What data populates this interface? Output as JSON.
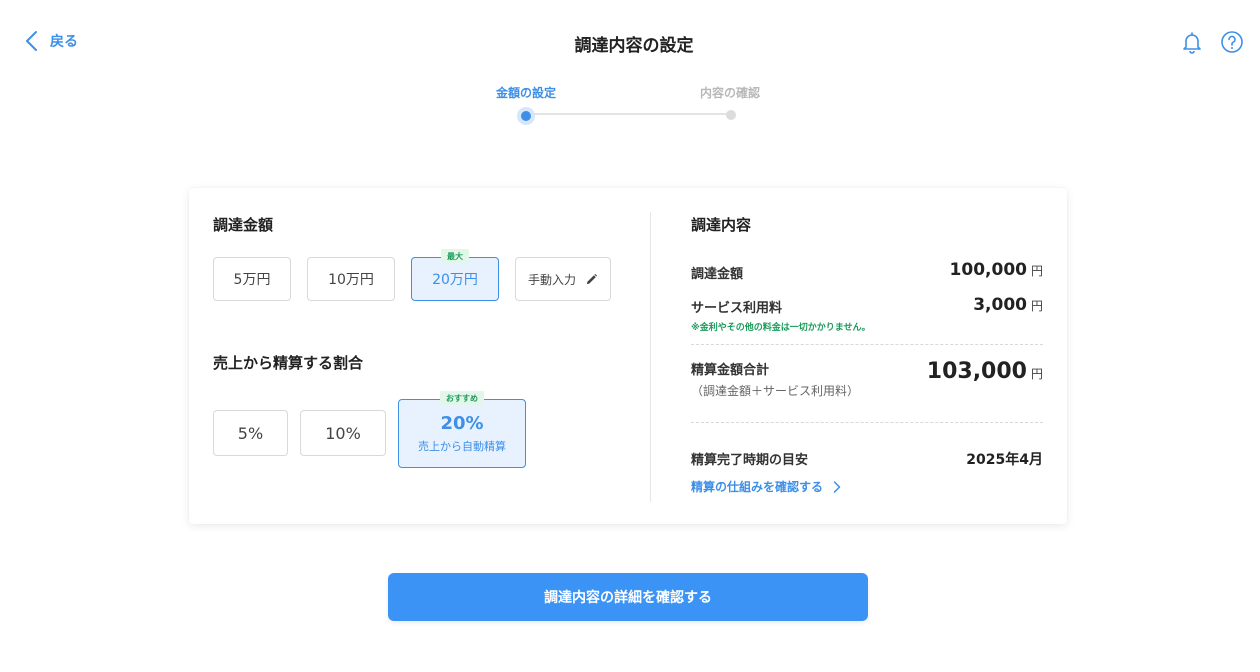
{
  "header": {
    "back_label": "戻る",
    "title": "調達内容の設定",
    "icons": [
      "chevron-left-icon",
      "bell-icon",
      "help-icon"
    ]
  },
  "stepper": {
    "steps": [
      {
        "label": "金額の設定",
        "status": "active"
      },
      {
        "label": "内容の確認",
        "status": "inactive"
      }
    ]
  },
  "amount_section": {
    "title": "調達金額",
    "options": [
      {
        "label": "5万円",
        "selected": false
      },
      {
        "label": "10万円",
        "selected": false
      },
      {
        "label": "20万円",
        "selected": true,
        "badge": "最大"
      },
      {
        "label": "手動入力",
        "selected": false,
        "icon": "pencil-icon"
      }
    ]
  },
  "ratio_section": {
    "title": "売上から精算する割合",
    "options": [
      {
        "label": "5%",
        "selected": false
      },
      {
        "label": "10%",
        "selected": false
      },
      {
        "label": "20%",
        "sub_label": "売上から自動精算",
        "selected": true,
        "badge": "おすすめ"
      }
    ]
  },
  "summary": {
    "title": "調達内容",
    "rows": [
      {
        "label": "調達金額",
        "value": "100,000",
        "unit": "円"
      },
      {
        "label": "サービス利用料",
        "value": "3,000",
        "unit": "円",
        "note": "※金利やその他の料金は一切かかりません。"
      }
    ],
    "total": {
      "label": "精算金額合計",
      "sub_label": "（調達金額＋サービス利用料）",
      "value": "103,000",
      "unit": "円"
    },
    "completion": {
      "label": "精算完了時期の目安",
      "value": "2025年4月"
    },
    "link_label": "精算の仕組みを確認する"
  },
  "cta_label": "調達内容の詳細を確認する",
  "colors": {
    "accent": "#3d8fe8",
    "accent_bg": "#e8f2fe",
    "badge_green": "#1c9b5a",
    "cta": "#3b93f5"
  }
}
